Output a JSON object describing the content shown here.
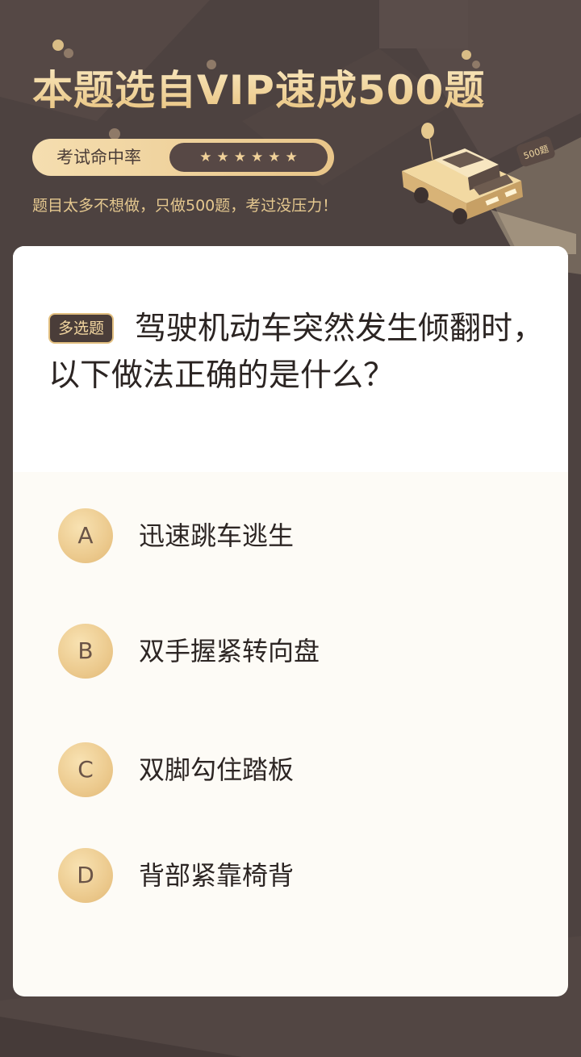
{
  "banner": {
    "title": "本题选自VIP速成500题",
    "rate_label": "考试命中率",
    "stars": [
      "★",
      "★",
      "★",
      "★",
      "★",
      "★"
    ],
    "subtitle": "题目太多不想做，只做500题，考过没压力！",
    "car_badge": "500题"
  },
  "question": {
    "type_badge": "多选题",
    "text": "驾驶机动车突然发生倾翻时，以下做法正确的是什么？"
  },
  "options": [
    {
      "letter": "A",
      "text": "迅速跳车逃生"
    },
    {
      "letter": "B",
      "text": "双手握紧转向盘"
    },
    {
      "letter": "C",
      "text": "双脚勾住踏板"
    },
    {
      "letter": "D",
      "text": "背部紧靠椅背"
    }
  ],
  "colors": {
    "background": "#4d4240",
    "gold": "#ecca8e",
    "card": "#fdfbf6",
    "badge_bg": "#4a3d39"
  }
}
